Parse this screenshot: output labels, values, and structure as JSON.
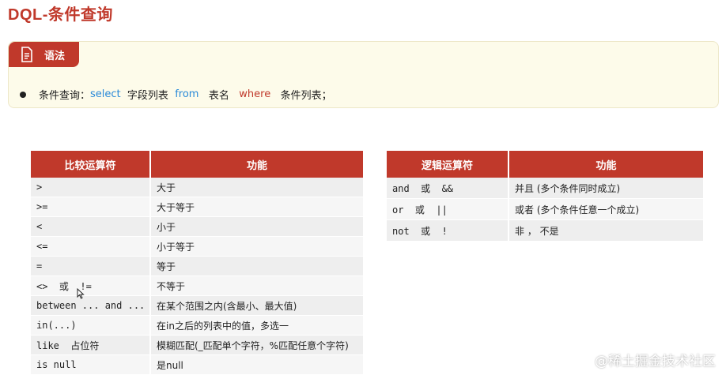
{
  "title": "DQL-条件查询",
  "syntax": {
    "tag_label": "语法",
    "tag_icon": "document-icon",
    "prefix": "条件查询：",
    "kw_select": "select",
    "part_fields": "字段列表",
    "kw_from": "from",
    "part_table": "表名",
    "kw_where": "where",
    "part_conditions": "条件列表；"
  },
  "comparison_table": {
    "headers": [
      "比较运算符",
      "功能"
    ],
    "rows": [
      {
        "op": ">",
        "desc": "大于"
      },
      {
        "op": ">=",
        "desc": "大于等于"
      },
      {
        "op": "<",
        "desc": "小于"
      },
      {
        "op": "<=",
        "desc": "小于等于"
      },
      {
        "op": "=",
        "desc": "等于"
      },
      {
        "op": "<>  或  !=",
        "desc": "不等于"
      },
      {
        "op": "between ... and ...",
        "desc": "在某个范围之内(含最小、最大值)"
      },
      {
        "op": "in(...)",
        "desc": "在in之后的列表中的值，多选一"
      },
      {
        "op": "like  占位符",
        "desc": "模糊匹配(_匹配单个字符，%匹配任意个字符)"
      },
      {
        "op": "is null",
        "desc": "是null"
      }
    ]
  },
  "logic_table": {
    "headers": [
      "逻辑运算符",
      "功能"
    ],
    "rows": [
      {
        "op": "and  或  &&",
        "desc": "并且 (多个条件同时成立)"
      },
      {
        "op": "or  或  ||",
        "desc": "或者 (多个条件任意一个成立)"
      },
      {
        "op": "not  或  !",
        "desc": "非 ， 不是"
      }
    ]
  },
  "watermark": "@稀土掘金技术社区",
  "colors": {
    "accent": "#c0392b",
    "keyword_blue": "#2a8ad8",
    "syntax_bg": "#fdfbea"
  }
}
